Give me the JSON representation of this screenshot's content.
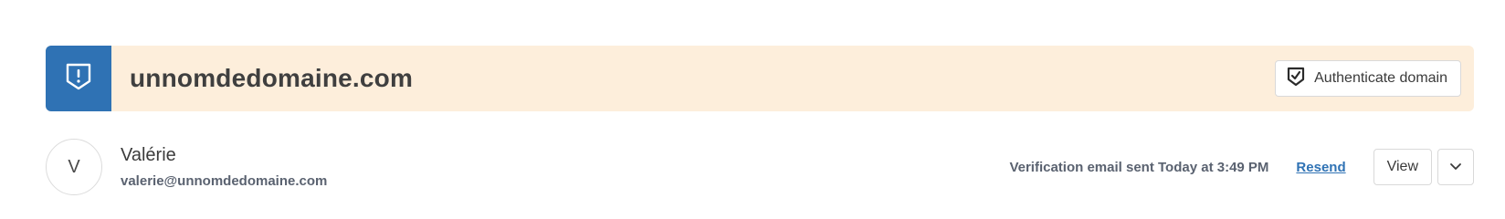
{
  "domain": {
    "name": "unnomdedomaine.com",
    "status_icon": "shield-alert-icon",
    "accent_color": "#2f72b4",
    "banner_color": "#fdeedb",
    "authenticate_label": "Authenticate domain",
    "authenticate_icon": "shield-check-icon"
  },
  "member": {
    "initial": "V",
    "name": "Valérie",
    "email": "valerie@unnomdedomaine.com",
    "verification_text": "Verification email sent Today at 3:49 PM",
    "resend_label": "Resend",
    "view_label": "View",
    "more_icon": "chevron-down-icon"
  }
}
